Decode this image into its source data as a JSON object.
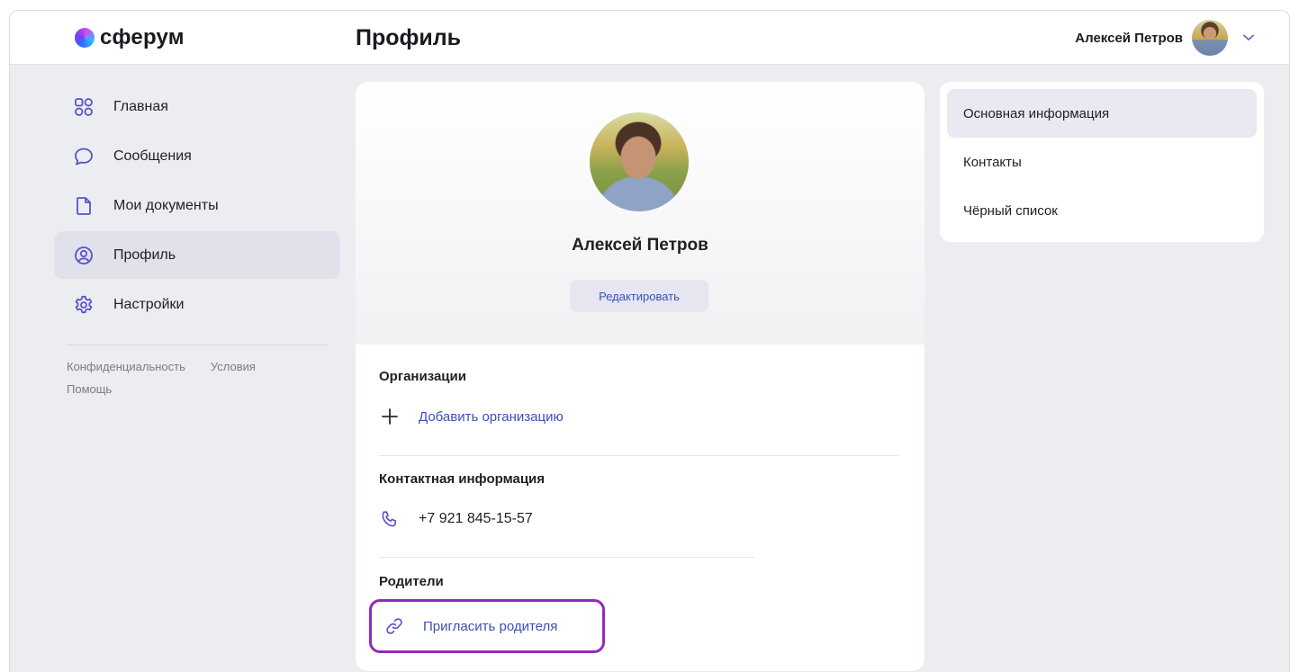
{
  "app": {
    "logo_text": "сферум"
  },
  "header": {
    "title": "Профиль",
    "user_name": "Алексей Петров"
  },
  "sidebar": {
    "items": [
      {
        "label": "Главная",
        "icon": "grid-icon"
      },
      {
        "label": "Сообщения",
        "icon": "chat-bubble-icon"
      },
      {
        "label": "Мои документы",
        "icon": "document-icon"
      },
      {
        "label": "Профиль",
        "icon": "user-circle-icon",
        "active": true
      },
      {
        "label": "Настройки",
        "icon": "gear-icon"
      }
    ],
    "footer_links": [
      "Конфиденциальность",
      "Условия",
      "Помощь"
    ]
  },
  "profile": {
    "name": "Алексей Петров",
    "edit_label": "Редактировать",
    "organizations_title": "Организации",
    "add_organization_label": "Добавить организацию",
    "contacts_title": "Контактная информация",
    "phone": "+7 921 845-15-57",
    "parents_title": "Родители",
    "invite_parent_label": "Пригласить родителя"
  },
  "right_menu": {
    "items": [
      "Основная информация",
      "Контакты",
      "Чёрный список"
    ]
  },
  "colors": {
    "accent": "#3d4fb8",
    "highlight_border": "#8f2bbd",
    "background": "#ecedf1"
  }
}
